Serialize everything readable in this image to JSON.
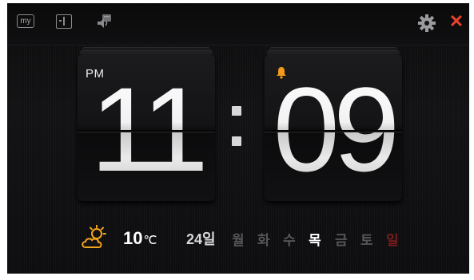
{
  "topbar": {
    "my_label": "my",
    "icons": [
      "my-icon",
      "layout-icon",
      "speaker-icon",
      "gear-icon",
      "close-icon"
    ],
    "close_glyph": "✕"
  },
  "clock": {
    "ampm": "PM",
    "hours": "11",
    "minutes": "09",
    "alarm_icon": "bell-icon",
    "alarm_color": "#f29a1c"
  },
  "weather": {
    "icon": "partly-cloudy-icon",
    "icon_color": "#f2a51c",
    "temperature": "10",
    "unit": "℃"
  },
  "calendar": {
    "date": "24일",
    "days": [
      "월",
      "화",
      "수",
      "목",
      "금",
      "토",
      "일"
    ],
    "today": "목"
  },
  "colors": {
    "accent_red": "#e8412c",
    "today_color": "#ffffff",
    "inactive_day": "#555558",
    "sunday_color": "#7a1d1d"
  }
}
